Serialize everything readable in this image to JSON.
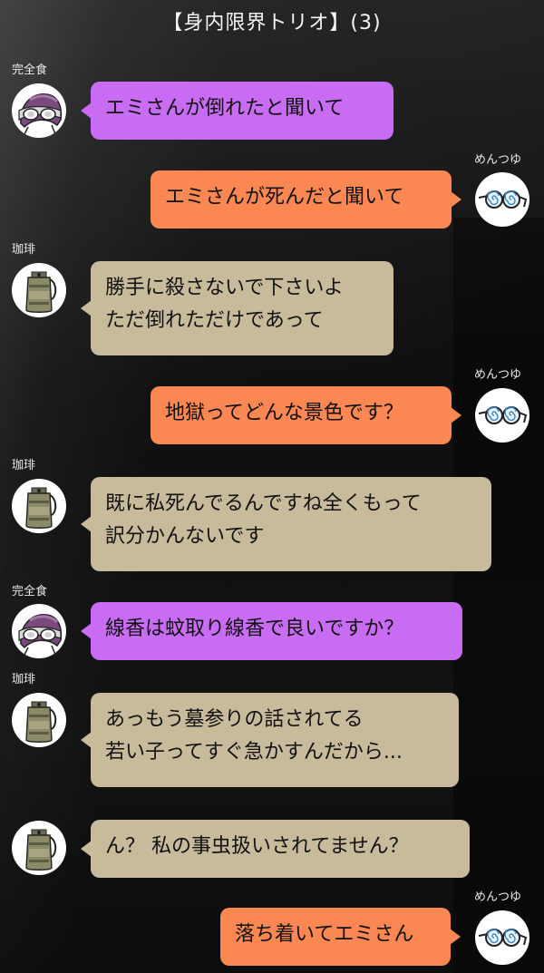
{
  "header": {
    "title": "【身内限界トリオ】(3)"
  },
  "senders": {
    "kanzen": "完全食",
    "coffee": "珈琲",
    "mentsuyu": "めんつゆ"
  },
  "colors": {
    "kanzen_bubble": "#c86cf3",
    "mentsuyu_bubble": "#fb8753",
    "coffee_bubble": "#c8bb9c"
  },
  "messages": [
    {
      "sender": "完全食",
      "side": "left",
      "lines": [
        "エミさんが倒れたと聞いて"
      ],
      "avatar_icon": "goggles-helmet-icon"
    },
    {
      "sender": "めんつゆ",
      "side": "right",
      "lines": [
        "エミさんが死んだと聞いて"
      ],
      "avatar_icon": "spiral-glasses-icon"
    },
    {
      "sender": "珈琲",
      "side": "left",
      "lines": [
        "勝手に殺さないで下さいよ",
        "ただ倒れただけであって"
      ],
      "avatar_icon": "coffee-can-icon"
    },
    {
      "sender": "めんつゆ",
      "side": "right",
      "lines": [
        "地獄ってどんな景色です？"
      ],
      "avatar_icon": "spiral-glasses-icon"
    },
    {
      "sender": "珈琲",
      "side": "left",
      "lines": [
        "既に私死んでるんですね全くもって",
        "訳分かんないです"
      ],
      "avatar_icon": "coffee-can-icon"
    },
    {
      "sender": "完全食",
      "side": "left",
      "lines": [
        "線香は蚊取り線香で良いですか？"
      ],
      "avatar_icon": "goggles-helmet-icon"
    },
    {
      "sender": "珈琲",
      "side": "left",
      "lines": [
        "あっもう墓参りの話されてる",
        "若い子ってすぐ急かすんだから..."
      ],
      "avatar_icon": "coffee-can-icon"
    },
    {
      "sender": "",
      "side": "left",
      "lines": [
        "ん？ 私の事虫扱いされてません？"
      ],
      "avatar_icon": "coffee-can-icon"
    },
    {
      "sender": "めんつゆ",
      "side": "right",
      "lines": [
        "落ち着いてエミさん"
      ],
      "avatar_icon": "spiral-glasses-icon"
    }
  ]
}
